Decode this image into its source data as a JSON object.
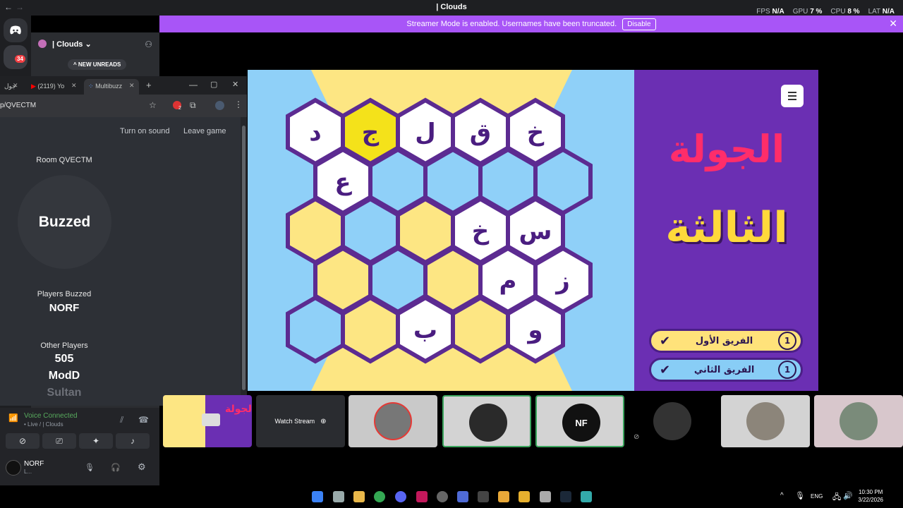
{
  "window": {
    "title": "| Clouds",
    "nav_back": "←",
    "nav_forward": "→",
    "stats": [
      {
        "label": "FPS",
        "value": "N/A"
      },
      {
        "label": "GPU",
        "value": "7 %"
      },
      {
        "label": "CPU",
        "value": "8 %"
      },
      {
        "label": "LAT",
        "value": "N/A"
      }
    ]
  },
  "banner": {
    "text": "Streamer Mode is enabled. Usernames have been truncated.",
    "disable_label": "Disable",
    "close": "✕"
  },
  "server_rail": {
    "badges": [
      "34"
    ]
  },
  "sidebar": {
    "server_name": "| Clouds",
    "chevron": "⌄",
    "new_unreads": "NEW UNREADS"
  },
  "voice": {
    "status": "Voice Connected",
    "subtext": "• Live / | Clouds"
  },
  "user": {
    "name": "NORF",
    "status": "L..."
  },
  "browser": {
    "tabs": [
      {
        "label": "جول"
      },
      {
        "label": "(2119) Yo"
      },
      {
        "label": "Multibuzz"
      }
    ],
    "new_tab": "+",
    "url": "p/QVECTM",
    "extension_badge": "2"
  },
  "multibuzz": {
    "turn_on_sound": "Turn on sound",
    "leave_game": "Leave game",
    "room": "Room QVECTM",
    "buzzed": "Buzzed",
    "players_buzzed_label": "Players Buzzed",
    "players_buzzed": [
      "NORF"
    ],
    "other_players_label": "Other Players",
    "other_players": [
      "505",
      "ModD",
      "Sultan"
    ]
  },
  "board": {
    "hex_letters": [
      [
        "د",
        "ج",
        "ل",
        "ق",
        "خ"
      ],
      [
        "ع",
        "",
        "",
        "",
        ""
      ],
      [
        "",
        "",
        "",
        "خ",
        "س"
      ],
      [
        "",
        "",
        "",
        "م",
        "ز"
      ],
      [
        "",
        "",
        "ب",
        "",
        "و"
      ]
    ],
    "hex_colors": [
      [
        "white",
        "yellow",
        "white",
        "white",
        "white"
      ],
      [
        "white",
        "blue",
        "blue",
        "blue",
        "blue"
      ],
      [
        "yellow",
        "blue",
        "yellow",
        "white",
        "white"
      ],
      [
        "yellow",
        "blue",
        "yellow",
        "white",
        "white"
      ],
      [
        "blue",
        "yellow",
        "white",
        "yellow",
        "white"
      ]
    ],
    "colors": {
      "white": "#ffffff",
      "yellow": "#fde683",
      "blue": "#8fd0f8",
      "highlight": "#f4e21a",
      "border": "#5c2b91"
    }
  },
  "round": {
    "title": "الجولة",
    "subtitle": "الثالثة"
  },
  "teams": [
    {
      "name": "الفريق الأول",
      "score": "1",
      "color": "#ffe27a"
    },
    {
      "name": "الفريق الثاني",
      "score": "1",
      "color": "#88cdf6"
    }
  ],
  "streams": {
    "watch_stream": "Watch Stream",
    "nf_label": "NF"
  },
  "taskbar": {
    "lang": "ENG",
    "time": "10:30 PM",
    "date": "3/22/2026"
  }
}
